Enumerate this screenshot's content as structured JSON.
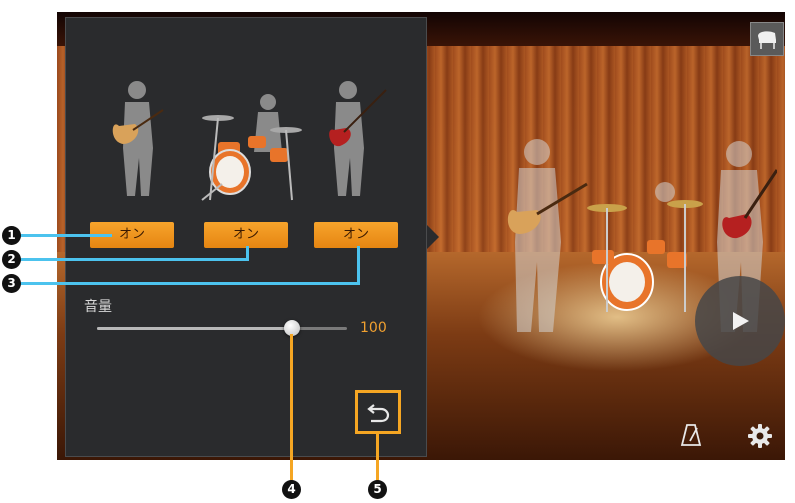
{
  "buttons": {
    "guitar": "オン",
    "drums": "オン",
    "bass": "オン"
  },
  "volume": {
    "label": "音量",
    "value": "100",
    "level": 0.79
  },
  "callouts": [
    "1",
    "2",
    "3",
    "4",
    "5"
  ],
  "icons": {
    "piano": "piano-icon",
    "play": "play-icon",
    "back": "back-icon",
    "metronome": "metronome-icon",
    "settings": "gear-icon"
  },
  "colors": {
    "accent": "#f5a623",
    "callout_line": "#4cc3ee",
    "panel": "#2a2b2d"
  }
}
